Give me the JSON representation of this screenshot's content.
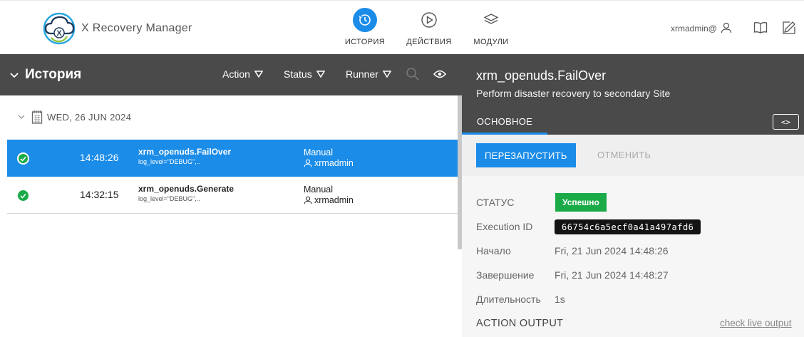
{
  "app": {
    "title": "X Recovery Manager"
  },
  "nav": {
    "history": "ИСТОРИЯ",
    "actions": "ДЕЙСТВИЯ",
    "modules": "МОДУЛИ"
  },
  "user": {
    "name": "xrmadmin@"
  },
  "history": {
    "title": "История",
    "filters": {
      "action": "Action",
      "status": "Status",
      "runner": "Runner"
    },
    "date": "WED, 26 JUN 2024",
    "rows": [
      {
        "time": "14:48:26",
        "name": "xrm_openuds.FailOver",
        "params": "log_level=\"DEBUG\",..",
        "runner_type": "Manual",
        "runner_user": "xrmadmin",
        "status": "success",
        "selected": true
      },
      {
        "time": "14:32:15",
        "name": "xrm_openuds.Generate",
        "params": "log_level=\"DEBUG\",..",
        "runner_type": "Manual",
        "runner_user": "xrmadmin",
        "status": "success",
        "selected": false
      }
    ]
  },
  "detail": {
    "title": "xrm_openuds.FailOver",
    "description": "Perform disaster recovery to secondary Site",
    "tab_main": "ОСНОВНОЕ",
    "code_toggle": "<>",
    "rerun_label": "ПЕРЕЗАПУСТИТЬ",
    "cancel_label": "ОТМЕНИТЬ",
    "status_label": "СТАТУС",
    "status_value": "Успешно",
    "execution_id_label": "Execution ID",
    "execution_id": "66754c6a5ecf0a41a497afd6",
    "start_label": "Начало",
    "start_value": "Fri, 21 Jun 2024 14:48:26",
    "end_label": "Завершение",
    "end_value": "Fri, 21 Jun 2024 14:48:27",
    "duration_label": "Длительность",
    "duration_value": "1s",
    "action_output_label": "ACTION OUTPUT",
    "live_output_link": "check live output"
  },
  "colors": {
    "accent": "#1b8ce8",
    "success": "#1aab48",
    "header_bg": "#4a4a4a"
  }
}
